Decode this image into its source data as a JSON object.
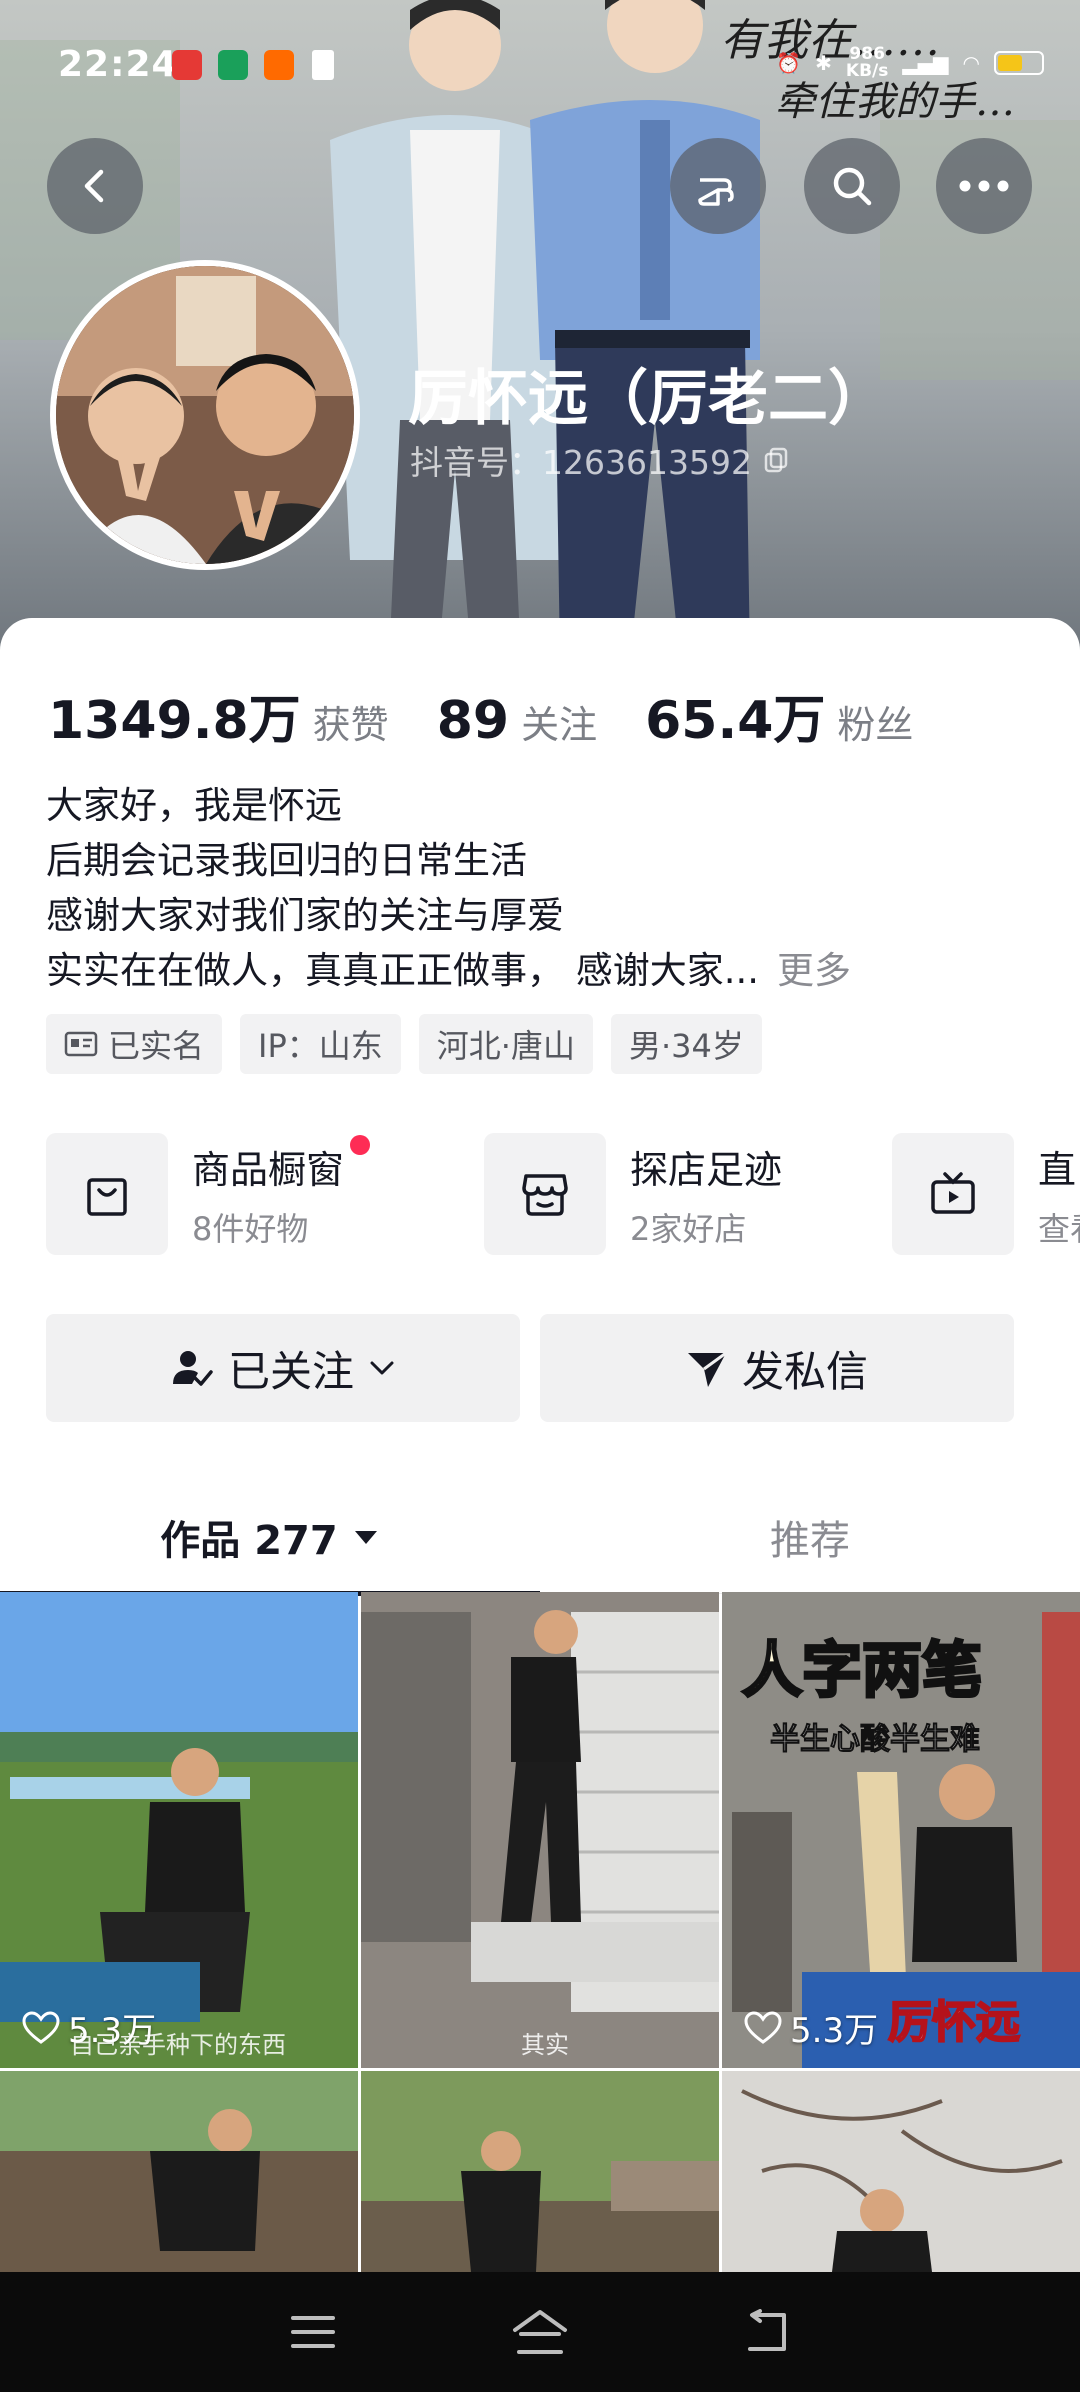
{
  "status_bar": {
    "time": "22:24",
    "net_speed_value": "986",
    "net_speed_unit": "KB/s",
    "battery_color": "#f5c518"
  },
  "header": {
    "back_icon": "chevron-left-icon",
    "share_icon": "pointing-hand-icon",
    "search_icon": "search-icon",
    "more_icon": "more-horizontal-icon",
    "banner_handwriting": "有我在……牵住我的手……"
  },
  "profile": {
    "name": "厉怀远（厉老二）",
    "douyin_id": "抖音号：1263613592"
  },
  "stats": [
    {
      "value": "1349.8万",
      "label": "获赞"
    },
    {
      "value": "89",
      "label": "关注"
    },
    {
      "value": "65.4万",
      "label": "粉丝"
    }
  ],
  "bio": {
    "lines": [
      "大家好，我是怀远",
      "后期会记录我回归的日常生活",
      "感谢大家对我们家的关注与厚爱",
      "实实在在做人，真真正正做事，   感谢大家..."
    ],
    "more_label": "更多"
  },
  "tags": [
    {
      "icon": "id-card-icon",
      "label": "已实名"
    },
    {
      "label": "IP：山东"
    },
    {
      "label": "河北·唐山"
    },
    {
      "label": "男·34岁"
    }
  ],
  "services": [
    {
      "icon": "shopping-bag-icon",
      "title": "商品橱窗",
      "subtitle": "8件好物",
      "has_dot": true
    },
    {
      "icon": "store-icon",
      "title": "探店足迹",
      "subtitle": "2家好店"
    },
    {
      "icon": "tv-play-icon",
      "title": "直",
      "subtitle": "查看"
    }
  ],
  "actions": {
    "follow_label": "已关注",
    "message_label": "发私信"
  },
  "tabs": {
    "works_label": "作品 277",
    "recommend_label": "推荐"
  },
  "videos": [
    {
      "likes": "5.3万",
      "caption": "自己亲手种下的东西"
    },
    {
      "caption": "其实"
    },
    {
      "likes": "5.3万",
      "title": "人字两笔",
      "subtitle": "半生心酸半生难",
      "badge": "厉怀远"
    },
    {},
    {},
    {}
  ],
  "colors": {
    "accent_red": "#fe2c55",
    "text_primary": "#161823",
    "text_secondary": "#8a8b91",
    "button_bg": "#f1f1f2"
  }
}
